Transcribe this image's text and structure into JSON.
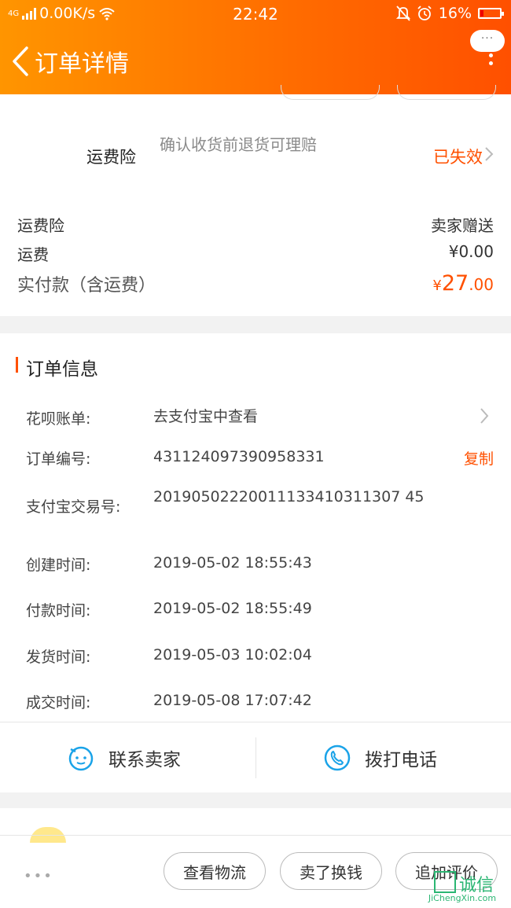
{
  "status_bar": {
    "network": "4G",
    "speed": "0.00K/s",
    "time": "22:42",
    "battery": "16%"
  },
  "header": {
    "title": "订单详情",
    "more_badge": "···"
  },
  "insurance": {
    "label": "运费险",
    "desc": "确认收货前退货可理赔",
    "status": "已失效"
  },
  "summary": {
    "rows": [
      {
        "label": "运费险",
        "value": "卖家赠送"
      },
      {
        "label": "运费",
        "value": "¥0.00"
      }
    ],
    "paid": {
      "label": "实付款（含运费）",
      "symbol": "¥",
      "integer": "27",
      "decimal": ".00"
    }
  },
  "order_info": {
    "title": "订单信息",
    "huabei": {
      "label": "花呗账单:",
      "value": "去支付宝中查看"
    },
    "order_no": {
      "label": "订单编号:",
      "value": "431124097390958331",
      "action": "复制"
    },
    "alipay_no": {
      "label": "支付宝交易号:",
      "value": "20190502220011133410311307 45"
    },
    "times": [
      {
        "label": "创建时间:",
        "value": "2019-05-02 18:55:43"
      },
      {
        "label": "付款时间:",
        "value": "2019-05-02 18:55:49"
      },
      {
        "label": "发货时间:",
        "value": "2019-05-03 10:02:04"
      },
      {
        "label": "成交时间:",
        "value": "2019-05-08 17:07:42"
      }
    ]
  },
  "contact": {
    "seller": "联系卖家",
    "phone": "拨打电话"
  },
  "bottom_bar": {
    "more": "•••",
    "logistics": "查看物流",
    "resell": "卖了换钱",
    "review": "追加评价"
  },
  "watermark": {
    "text": "诚信",
    "url": "JiChengXin.com"
  },
  "colors": {
    "accent": "#ff5000",
    "header_start": "#ff9500",
    "header_end": "#ff5000",
    "icon_blue": "#1aa3e8"
  }
}
